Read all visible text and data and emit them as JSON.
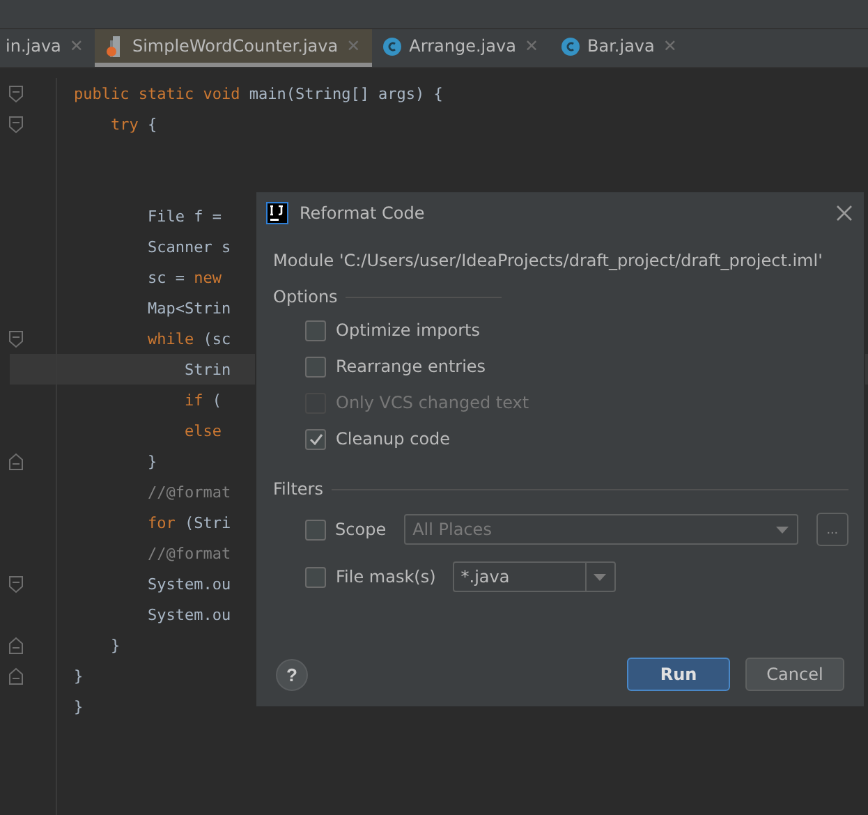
{
  "tabs": [
    {
      "label": "in.java",
      "kind": "plain",
      "close": "✕",
      "selected": false
    },
    {
      "label": "SimpleWordCounter.java",
      "kind": "file",
      "close": "✕",
      "selected": true
    },
    {
      "label": "Arrange.java",
      "kind": "class",
      "close": "✕",
      "selected": false
    },
    {
      "label": "Bar.java",
      "kind": "class",
      "close": "✕",
      "selected": false
    }
  ],
  "code": [
    {
      "kind": "fold-start",
      "current": false,
      "segments": [
        {
          "text": "public static void ",
          "kind": "keyword"
        },
        {
          "text": "main(String[] args) {",
          "kind": "plain"
        }
      ]
    },
    {
      "kind": "fold-start",
      "current": false,
      "segments": [
        {
          "text": "    try ",
          "kind": "keyword"
        },
        {
          "text": "{",
          "kind": "plain"
        }
      ]
    },
    {
      "kind": "plain",
      "current": false
    },
    {
      "kind": "plain",
      "current": false
    },
    {
      "kind": "plain",
      "current": false,
      "segments": [
        {
          "text": "        File f =",
          "kind": "plain"
        }
      ]
    },
    {
      "kind": "plain",
      "current": false,
      "segments": [
        {
          "text": "        Scanner s",
          "kind": "plain"
        }
      ]
    },
    {
      "kind": "plain",
      "current": false,
      "segments": [
        {
          "text": "        sc = ",
          "kind": "plain"
        },
        {
          "text": "new",
          "kind": "keyword"
        }
      ]
    },
    {
      "kind": "plain",
      "current": false,
      "segments": [
        {
          "text": "        Map<Strin",
          "kind": "plain"
        }
      ]
    },
    {
      "kind": "fold-start",
      "current": false,
      "segments": [
        {
          "text": "        while ",
          "kind": "keyword"
        },
        {
          "text": "(sc",
          "kind": "plain"
        }
      ]
    },
    {
      "kind": "plain",
      "current": true,
      "segments": [
        {
          "text": "            Strin",
          "kind": "plain"
        }
      ]
    },
    {
      "kind": "plain",
      "current": false,
      "segments": [
        {
          "text": "            if ",
          "kind": "keyword"
        },
        {
          "text": "(",
          "kind": "plain"
        }
      ]
    },
    {
      "kind": "plain",
      "current": false,
      "segments": [
        {
          "text": "            else",
          "kind": "keyword"
        }
      ]
    },
    {
      "kind": "fold-end",
      "current": false,
      "segments": [
        {
          "text": "        }",
          "kind": "plain"
        }
      ]
    },
    {
      "kind": "plain",
      "current": false,
      "segments": [
        {
          "text": "        //@format",
          "kind": "comment"
        }
      ]
    },
    {
      "kind": "plain",
      "current": false,
      "segments": [
        {
          "text": "        for ",
          "kind": "keyword"
        },
        {
          "text": "(Stri",
          "kind": "plain"
        }
      ]
    },
    {
      "kind": "plain",
      "current": false,
      "segments": [
        {
          "text": "        //@format",
          "kind": "comment"
        }
      ]
    },
    {
      "kind": "fold-start",
      "current": false,
      "segments": [
        {
          "text": "        System.ou",
          "kind": "plain"
        }
      ]
    },
    {
      "kind": "plain",
      "current": false,
      "segments": [
        {
          "text": "        System.ou",
          "kind": "plain"
        }
      ]
    },
    {
      "kind": "fold-end",
      "current": false,
      "segments": [
        {
          "text": "    }",
          "kind": "plain"
        }
      ]
    },
    {
      "kind": "fold-end",
      "current": false,
      "segments": [
        {
          "text": "}",
          "kind": "plain"
        }
      ]
    },
    {
      "kind": "plain",
      "current": false,
      "segments": [
        {
          "text": "}",
          "kind": "plain"
        }
      ]
    }
  ],
  "dialog": {
    "title": "Reformat Code",
    "module": "Module 'C:/Users/user/IdeaProjects/draft_project/draft_project.iml'",
    "options_label": "Options",
    "options": [
      {
        "label": "Optimize imports",
        "checked": false,
        "disabled": false
      },
      {
        "label": "Rearrange entries",
        "checked": false,
        "disabled": false
      },
      {
        "label": "Only VCS changed text",
        "checked": false,
        "disabled": true
      },
      {
        "label": "Cleanup code",
        "checked": true,
        "disabled": false
      }
    ],
    "filters_label": "Filters",
    "scope": {
      "label": "Scope",
      "checked": false,
      "value": "All Places",
      "more": "..."
    },
    "file_mask": {
      "label": "File mask(s)",
      "checked": false,
      "value": "*.java"
    },
    "help": "?",
    "buttons": [
      {
        "label": "Run",
        "kind": "primary"
      },
      {
        "label": "Cancel",
        "kind": "secondary"
      }
    ]
  }
}
